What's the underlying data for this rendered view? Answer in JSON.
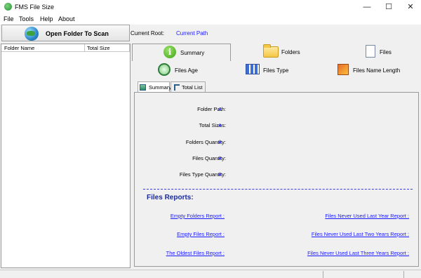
{
  "window": {
    "title": "FMS File Size",
    "minimize": "—",
    "maximize": "☐",
    "close": "✕"
  },
  "menu": [
    "File",
    "Tools",
    "Help",
    "About"
  ],
  "toolbar": {
    "open_label": "Open Folder To Scan",
    "current_root_label": "Current Root:",
    "current_root_value": "Current Path"
  },
  "left_panel": {
    "columns": [
      "Folder Name",
      "Total Size"
    ]
  },
  "tabs_row1": [
    "Summary",
    "Folders",
    "Files"
  ],
  "tabs_row2": [
    "Files Age",
    "Files Type",
    "Files Name Length"
  ],
  "sub_tabs": [
    "Summary",
    "Total List"
  ],
  "summary": {
    "rows": [
      {
        "label": "Folder Path:",
        "value": "A"
      },
      {
        "label": "Total Sizes:",
        "value": "A"
      },
      {
        "label": "Folders Quantity:",
        "value": "A"
      },
      {
        "label": "Files Quantity:",
        "value": "A"
      },
      {
        "label": "Files Type Quantity:",
        "value": "A"
      }
    ]
  },
  "reports": {
    "title": "Files Reports:",
    "left": [
      "Empty Folders Report :",
      "Empty Files Report :",
      "The Oldest Files Report :"
    ],
    "right": [
      "Files Never Used Last Year Report :",
      "Files Never Used Last Two Years Report :",
      "Files Never Used Last Three Years Report :"
    ]
  }
}
